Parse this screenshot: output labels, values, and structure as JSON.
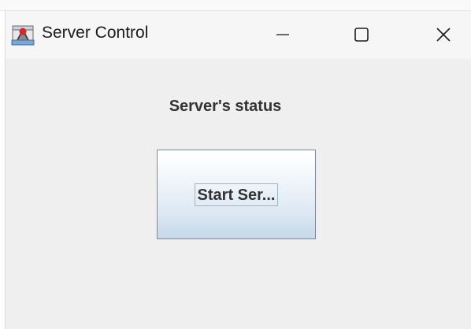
{
  "window": {
    "title": "Server Control",
    "icon": "java-app-icon",
    "controls": {
      "minimize_icon": "minimize-icon",
      "maximize_icon": "maximize-icon",
      "close_icon": "close-icon"
    }
  },
  "main": {
    "status_label": "Server's status",
    "start_button_label": "Start Ser..."
  },
  "colors": {
    "client_background": "#efefef",
    "titlebar_background": "#f6f6f6",
    "button_border": "#7a8aa3",
    "text": "#333333"
  }
}
